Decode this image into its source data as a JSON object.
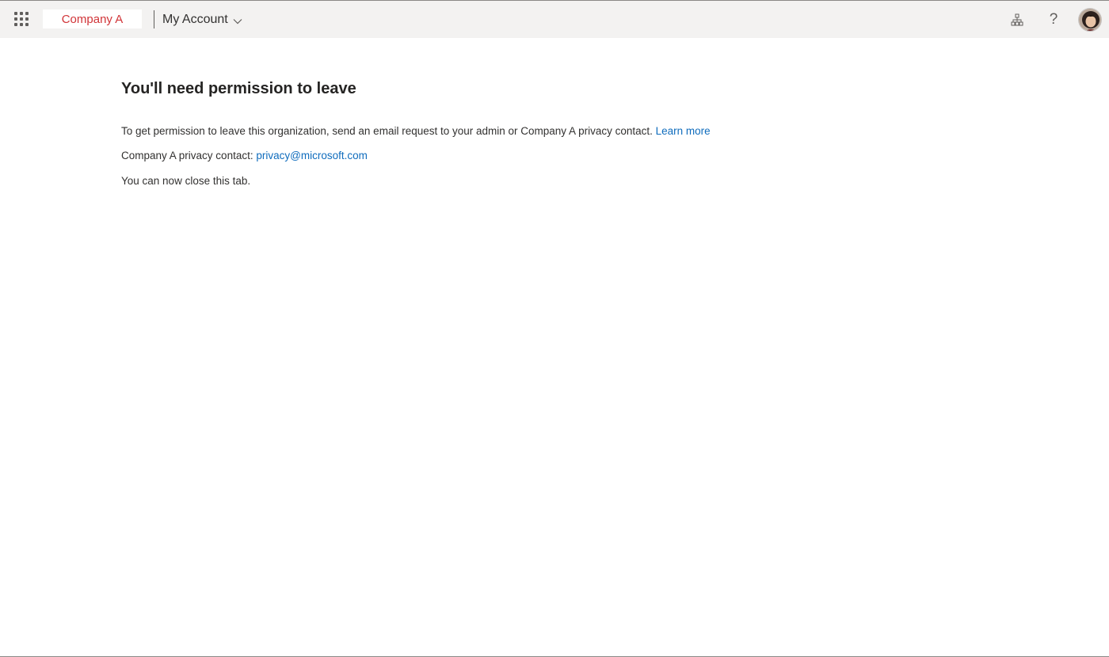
{
  "header": {
    "app_launcher_icon": "waffle-icon",
    "company_name": "Company A",
    "app_title": "My Account",
    "app_title_icon": "chevron-down-icon",
    "org_icon": "org-chart-icon",
    "help_label": "?",
    "avatar_icon": "user-avatar"
  },
  "main": {
    "title": "You'll need permission to leave",
    "paragraph1_text": "To get permission to leave this organization, send an email request to your admin or Company A privacy contact.",
    "learn_more_link": "Learn more",
    "privacy_label": "Company A privacy contact:",
    "privacy_email": "privacy@microsoft.com",
    "close_text": "You can now close this tab."
  },
  "colors": {
    "header_bg": "#f3f2f1",
    "brand_red": "#d13438",
    "link_blue": "#0f6cbd",
    "text": "#323130"
  }
}
